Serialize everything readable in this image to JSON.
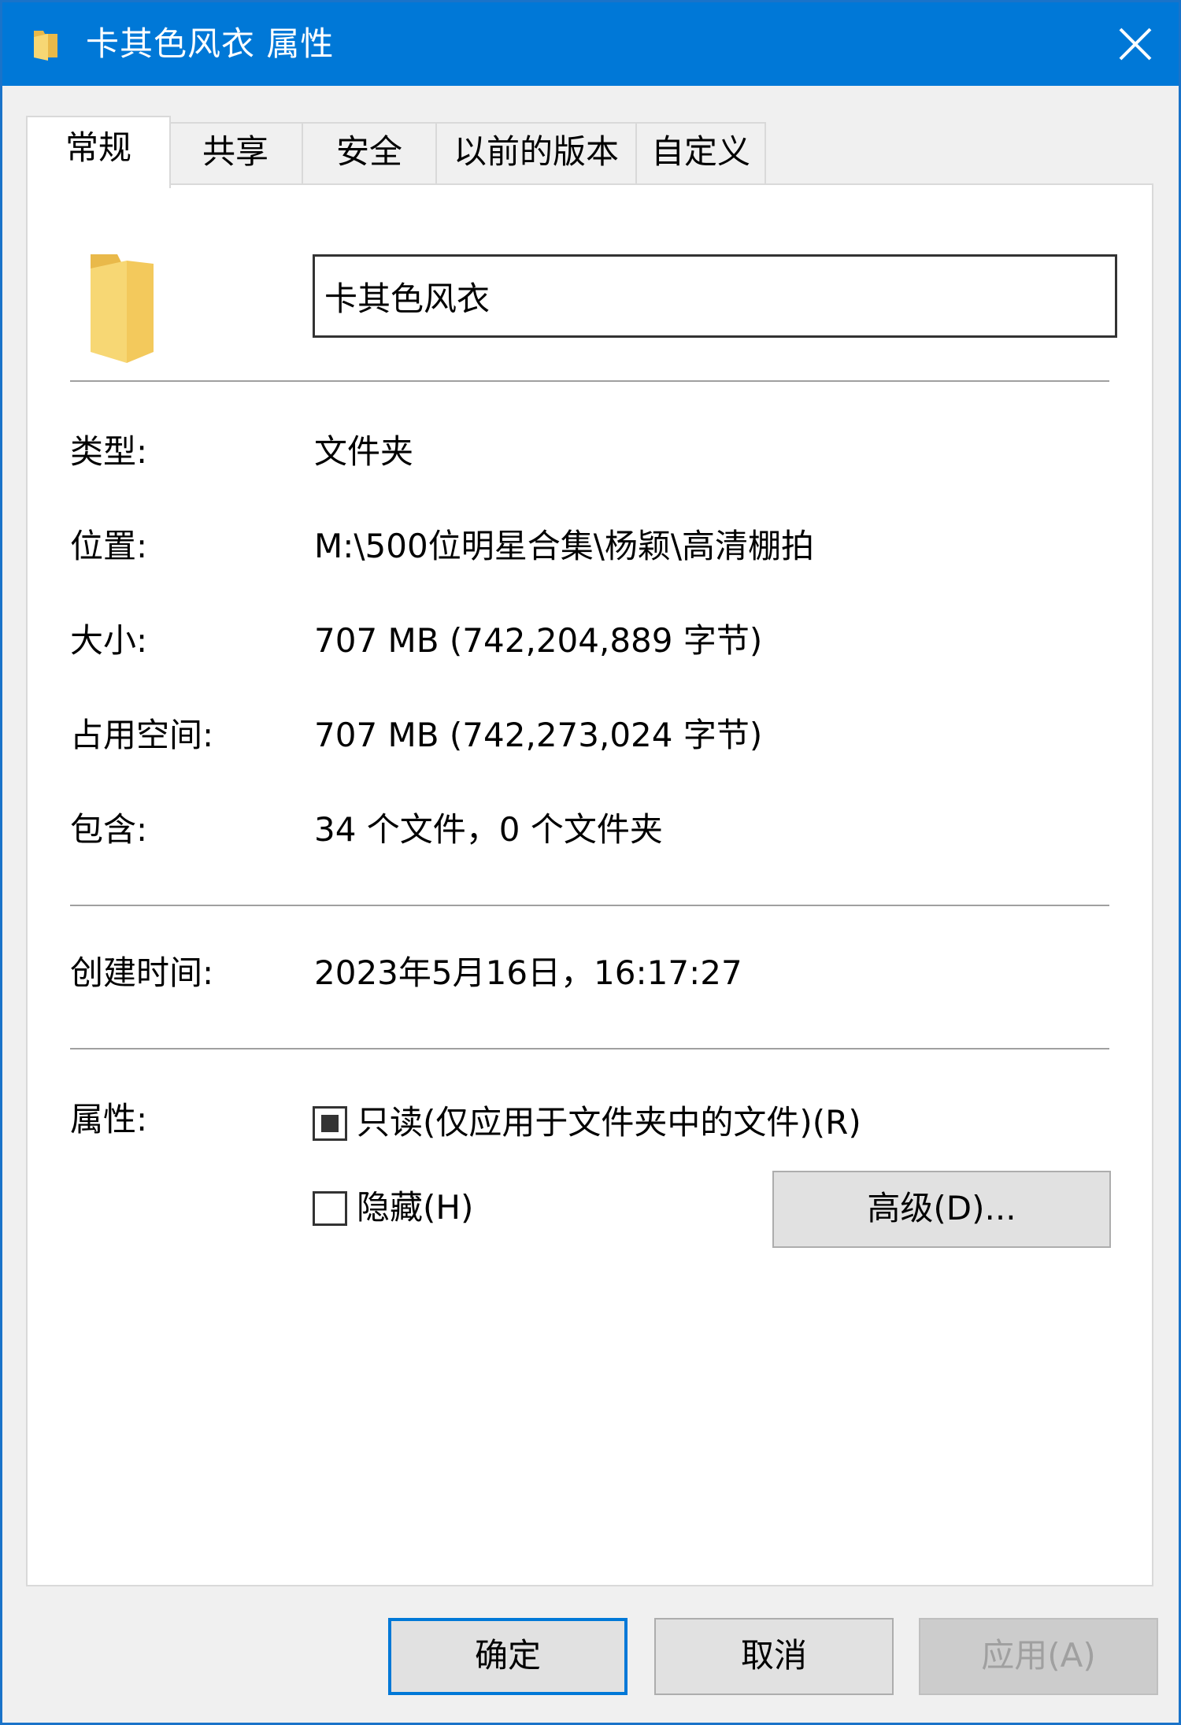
{
  "window": {
    "title": "卡其色风衣 属性"
  },
  "tabs": [
    {
      "label": "常规",
      "active": true
    },
    {
      "label": "共享",
      "active": false
    },
    {
      "label": "安全",
      "active": false
    },
    {
      "label": "以前的版本",
      "active": false
    },
    {
      "label": "自定义",
      "active": false
    }
  ],
  "general": {
    "folder_name": "卡其色风衣",
    "type_label": "类型:",
    "type_value": "文件夹",
    "location_label": "位置:",
    "location_value": "M:\\500位明星合集\\杨颖\\高清棚拍",
    "size_label": "大小:",
    "size_value": "707 MB (742,204,889 字节)",
    "disk_size_label": "占用空间:",
    "disk_size_value": "707 MB (742,273,024 字节)",
    "contains_label": "包含:",
    "contains_value": "34 个文件，0 个文件夹",
    "created_label": "创建时间:",
    "created_value": "2023年5月16日，16:17:27",
    "attributes_label": "属性:",
    "readonly_label": "只读(仅应用于文件夹中的文件)(R)",
    "readonly_state": "indeterminate",
    "hidden_label": "隐藏(H)",
    "hidden_state": "unchecked",
    "advanced_button": "高级(D)..."
  },
  "footer": {
    "ok": "确定",
    "cancel": "取消",
    "apply": "应用(A)"
  },
  "colors": {
    "titlebar": "#0078d7",
    "folder": "#f7d774"
  },
  "icons": {
    "title_icon": "folder-icon",
    "close_icon": "close-icon",
    "big_icon": "folder-icon"
  }
}
